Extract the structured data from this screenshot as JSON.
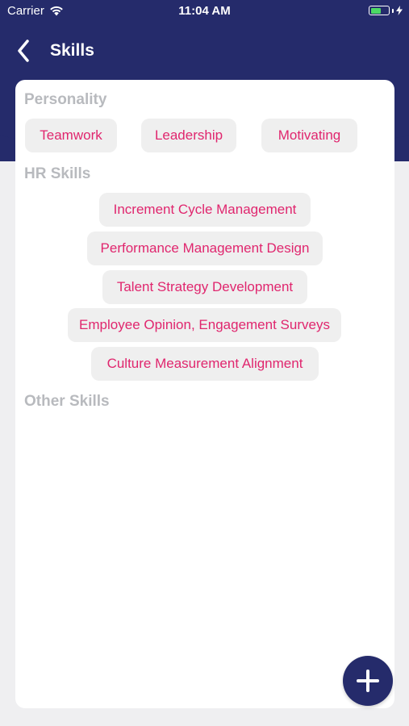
{
  "status_bar": {
    "carrier": "Carrier",
    "time": "11:04 AM",
    "wifi_icon": "wifi-icon",
    "battery_icon": "battery-icon",
    "charging_icon": "bolt-icon"
  },
  "nav": {
    "back_icon": "chevron-left-icon",
    "title": "Skills"
  },
  "sections": {
    "personality": {
      "title": "Personality",
      "chips": [
        "Teamwork",
        "Leadership",
        "Motivating"
      ]
    },
    "hr_skills": {
      "title": "HR Skills",
      "chips": [
        "Increment Cycle Management",
        "Performance Management Design",
        "Talent Strategy Development",
        "Employee Opinion, Engagement Surveys",
        "Culture Measurement Alignment"
      ]
    },
    "other_skills": {
      "title": "Other Skills",
      "chips": []
    }
  },
  "fab": {
    "icon": "plus-icon"
  },
  "colors": {
    "header": "#252b6b",
    "chip_text": "#e0266e",
    "chip_bg": "#efefef",
    "section_title": "#b8babe",
    "background": "#efeff1"
  }
}
